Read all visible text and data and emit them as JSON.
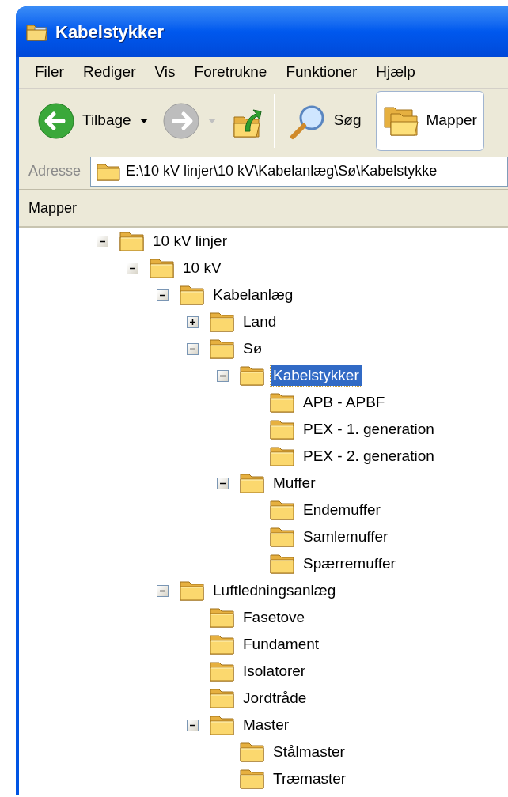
{
  "window": {
    "title": "Kabelstykker"
  },
  "menu": [
    {
      "label": "Filer"
    },
    {
      "label": "Rediger"
    },
    {
      "label": "Vis"
    },
    {
      "label": "Foretrukne"
    },
    {
      "label": "Funktioner"
    },
    {
      "label": "Hjælp"
    }
  ],
  "toolbar": [
    {
      "kind": "back",
      "label": "Tilbage",
      "disabled": false
    },
    {
      "kind": "forward",
      "disabled": true
    },
    {
      "kind": "up",
      "disabled": false
    },
    {
      "kind": "separator"
    },
    {
      "kind": "search",
      "label": "Søg",
      "selected": false
    },
    {
      "kind": "folders",
      "label": "Mapper",
      "selected": true
    }
  ],
  "address": {
    "label": "Adresse",
    "value": "E:\\10 kV linjer\\10 kV\\Kabelanlæg\\Sø\\Kabelstykke"
  },
  "pane": {
    "title": "Mapper"
  },
  "tree": [
    {
      "label": "10 kV linjer",
      "expanded": true,
      "selected": false,
      "children": [
        {
          "label": "10 kV",
          "expanded": true,
          "selected": false,
          "children": [
            {
              "label": "Kabelanlæg",
              "expanded": true,
              "selected": false,
              "children": [
                {
                  "label": "Land",
                  "expanded": false,
                  "selected": false
                },
                {
                  "label": "Sø",
                  "expanded": true,
                  "selected": false,
                  "children": [
                    {
                      "label": "Kabelstykker",
                      "expanded": true,
                      "selected": true,
                      "children": [
                        {
                          "label": "APB - APBF",
                          "selected": false
                        },
                        {
                          "label": "PEX - 1. generation",
                          "selected": false
                        },
                        {
                          "label": "PEX - 2. generation",
                          "selected": false
                        }
                      ]
                    },
                    {
                      "label": "Muffer",
                      "expanded": true,
                      "selected": false,
                      "children": [
                        {
                          "label": "Endemuffer",
                          "selected": false
                        },
                        {
                          "label": "Samlemuffer",
                          "selected": false
                        },
                        {
                          "label": "Spærremuffer",
                          "selected": false
                        }
                      ]
                    }
                  ]
                }
              ]
            },
            {
              "label": "Luftledningsanlæg",
              "expanded": true,
              "selected": false,
              "children": [
                {
                  "label": "Fasetove",
                  "selected": false
                },
                {
                  "label": "Fundament",
                  "selected": false
                },
                {
                  "label": "Isolatorer",
                  "selected": false
                },
                {
                  "label": "Jordtråde",
                  "selected": false
                },
                {
                  "label": "Master",
                  "expanded": true,
                  "selected": false,
                  "children": [
                    {
                      "label": "Stålmaster",
                      "selected": false
                    },
                    {
                      "label": "Træmaster",
                      "selected": false
                    }
                  ]
                }
              ]
            }
          ]
        }
      ]
    }
  ]
}
